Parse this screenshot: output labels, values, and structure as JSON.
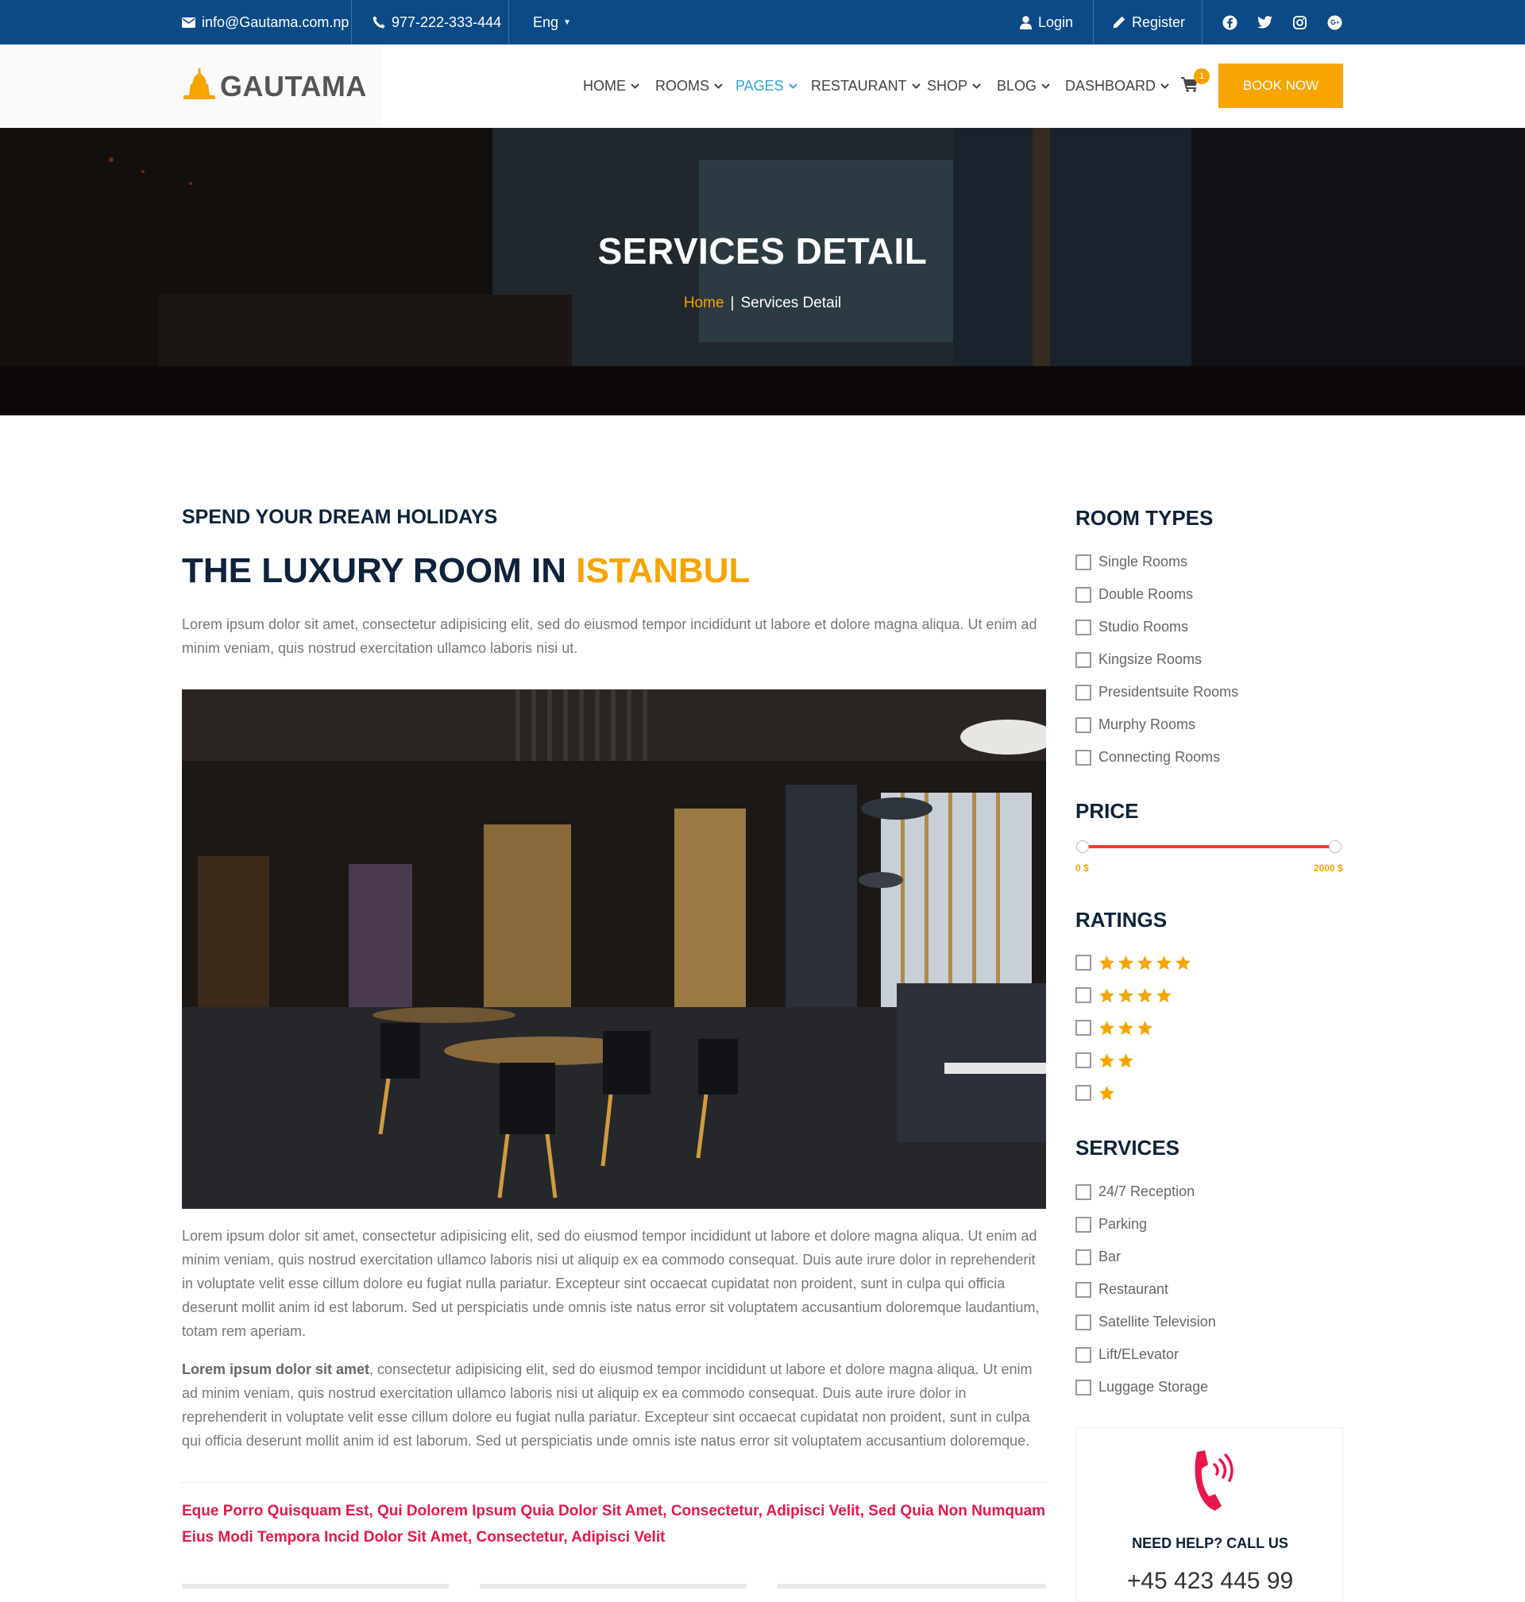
{
  "topbar": {
    "email": "info@Gautama.com.np",
    "phone": "977-222-333-444",
    "language": "Eng",
    "login": "Login",
    "register": "Register",
    "social_icons": [
      "facebook-icon",
      "twitter-icon",
      "instagram-icon",
      "google-plus-icon"
    ]
  },
  "header": {
    "logo_text": "GAUTAMA",
    "nav": [
      "HOME",
      "ROOMS",
      "PAGES",
      "RESTAURANT",
      "SHOP",
      "BLOG",
      "DASHBOARD"
    ],
    "active_nav": "PAGES",
    "cart_count": "1",
    "book_button": "BOOK NOW"
  },
  "hero": {
    "title": "SERVICES DETAIL",
    "breadcrumb_home": "Home",
    "breadcrumb_separator": "|",
    "breadcrumb_current": "Services Detail"
  },
  "main": {
    "subtitle": "SPEND YOUR DREAM HOLIDAYS",
    "title_prefix": "THE LUXURY ROOM IN",
    "title_accent": "ISTANBUL",
    "intro": "Lorem ipsum dolor sit amet, consectetur adipisicing elit, sed do eiusmod tempor incididunt ut labore et dolore magna aliqua. Ut enim ad minim veniam, quis nostrud exercitation ullamco laboris nisi ut.",
    "paragraph1": "Lorem ipsum dolor sit amet, consectetur adipisicing elit, sed do eiusmod tempor incididunt ut labore et dolore magna aliqua. Ut enim ad minim veniam, quis nostrud exercitation ullamco laboris nisi ut aliquip ex ea commodo consequat. Duis aute irure dolor in reprehenderit in voluptate velit esse cillum dolore eu fugiat nulla pariatur. Excepteur sint occaecat cupidatat non proident, sunt in culpa qui officia deserunt mollit anim id est laborum. Sed ut perspiciatis unde omnis iste natus error sit voluptatem accusantium doloremque laudantium, totam rem aperiam.",
    "paragraph2_bold": "Lorem ipsum dolor sit amet",
    "paragraph2_rest": ", consectetur adipisicing elit, sed do eiusmod tempor incididunt ut labore et dolore magna aliqua. Ut enim ad minim veniam, quis nostrud exercitation ullamco laboris nisi ut aliquip ex ea commodo consequat. Duis aute irure dolor in reprehenderit in voluptate velit esse cillum dolore eu fugiat nulla pariatur. Excepteur sint occaecat cupidatat non proident, sunt in culpa qui officia deserunt mollit anim id est laborum. Sed ut perspiciatis unde omnis iste natus error sit voluptatem accusantium doloremque.",
    "quote": "Eque Porro Quisquam Est, Qui Dolorem Ipsum Quia Dolor Sit Amet, Consectetur, Adipisci Velit, Sed Quia Non Numquam Eius Modi Tempora Incid Dolor Sit Amet, Consectetur, Adipisci Velit"
  },
  "sidebar": {
    "room_types_title": "ROOM TYPES",
    "room_types": [
      "Single Rooms",
      "Double Rooms",
      "Studio Rooms",
      "Kingsize Rooms",
      "Presidentsuite Rooms",
      "Murphy Rooms",
      "Connecting Rooms"
    ],
    "price_title": "PRICE",
    "price_min": "0 $",
    "price_max": "2000 $",
    "price_range_fraction": [
      0,
      1
    ],
    "ratings_title": "RATINGS",
    "ratings": [
      5,
      4,
      3,
      2,
      1
    ],
    "services_title": "SERVICES",
    "services": [
      "24/7 Reception",
      "Parking",
      "Bar",
      "Restaurant",
      "Satellite Television",
      "Lift/ELevator",
      "Luggage Storage"
    ],
    "help_title": "NEED HELP? CALL US",
    "help_phone": "+45 423 445 99"
  },
  "colors": {
    "topbar_bg": "#0b4a86",
    "accent_orange": "#f7a400",
    "active_nav_blue": "#2fa4de",
    "heading_navy": "#0f2239",
    "quote_red": "#e8174a",
    "price_track": "#f03c2c"
  }
}
